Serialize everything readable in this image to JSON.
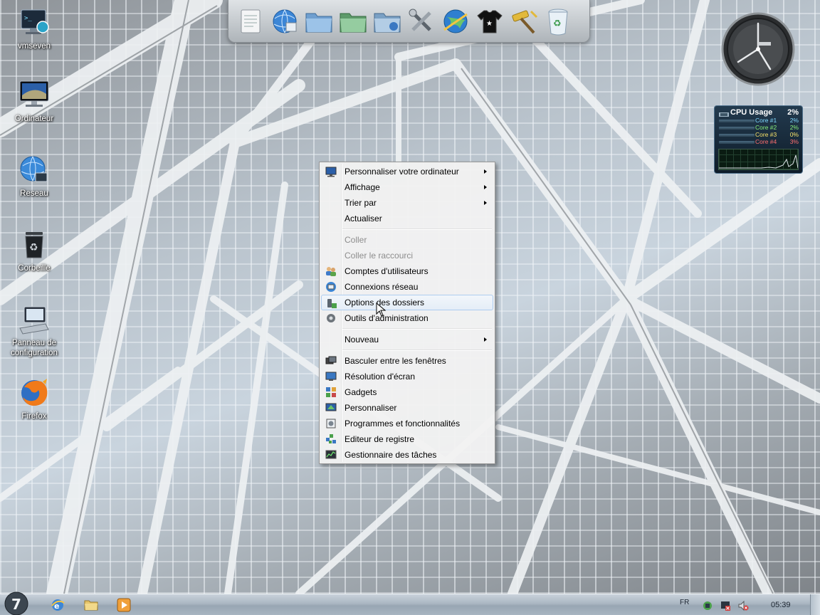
{
  "desktop": {
    "icons": [
      {
        "label": "vmseven",
        "icon": "monitor-terminal-icon"
      },
      {
        "label": "Ordinateur",
        "icon": "computer-icon"
      },
      {
        "label": "Reseau",
        "icon": "network-globe-icon"
      },
      {
        "label": "Corbeille",
        "icon": "recycle-bin-icon"
      },
      {
        "label": "Panneau de configuration",
        "icon": "control-panel-icon"
      },
      {
        "label": "Firefox",
        "icon": "firefox-icon"
      }
    ]
  },
  "dock": {
    "items": [
      "notepad-icon",
      "internet-explorer-icon",
      "folder-icon",
      "folder-green-icon",
      "folder-network-icon",
      "tools-icon",
      "network-globe-icon",
      "tshirt-icon",
      "hammer-icon",
      "recycle-bin-icon"
    ]
  },
  "gadgets": {
    "cpu": {
      "title": "CPU Usage",
      "total": "2%",
      "cores": [
        {
          "label": "Core #1",
          "value": "2%"
        },
        {
          "label": "Core #2",
          "value": "2%"
        },
        {
          "label": "Core #3",
          "value": "0%"
        },
        {
          "label": "Core #4",
          "value": "3%"
        }
      ]
    }
  },
  "context_menu": {
    "items": [
      {
        "label": "Personnaliser votre ordinateur",
        "submenu": true,
        "icon": "monitor-icon"
      },
      {
        "label": "Affichage",
        "submenu": true
      },
      {
        "label": "Trier par",
        "submenu": true
      },
      {
        "label": "Actualiser"
      },
      {
        "separator": true
      },
      {
        "label": "Coller",
        "disabled": true
      },
      {
        "label": "Coller le raccourci",
        "disabled": true
      },
      {
        "label": "Comptes d'utilisateurs",
        "icon": "users-icon"
      },
      {
        "label": "Connexions réseau",
        "icon": "network-connections-icon"
      },
      {
        "label": "Options des dossiers",
        "icon": "folder-options-icon",
        "hover": true
      },
      {
        "label": "Outils d'administration",
        "icon": "admin-tools-icon"
      },
      {
        "separator": true
      },
      {
        "label": "Nouveau",
        "submenu": true
      },
      {
        "separator": true
      },
      {
        "label": "Basculer entre les fenêtres",
        "icon": "switch-windows-icon"
      },
      {
        "label": "Résolution d'écran",
        "icon": "screen-resolution-icon"
      },
      {
        "label": "Gadgets",
        "icon": "gadgets-icon"
      },
      {
        "label": "Personnaliser",
        "icon": "personalize-icon"
      },
      {
        "label": "Programmes et fonctionnalités",
        "icon": "programs-icon"
      },
      {
        "label": "Editeur de registre",
        "icon": "registry-editor-icon"
      },
      {
        "label": "Gestionnaire des tâches",
        "icon": "task-manager-icon"
      }
    ]
  },
  "taskbar": {
    "pinned": [
      "internet-explorer-icon",
      "explorer-folder-icon",
      "media-player-icon"
    ],
    "language": "FR",
    "time": "05:39"
  }
}
